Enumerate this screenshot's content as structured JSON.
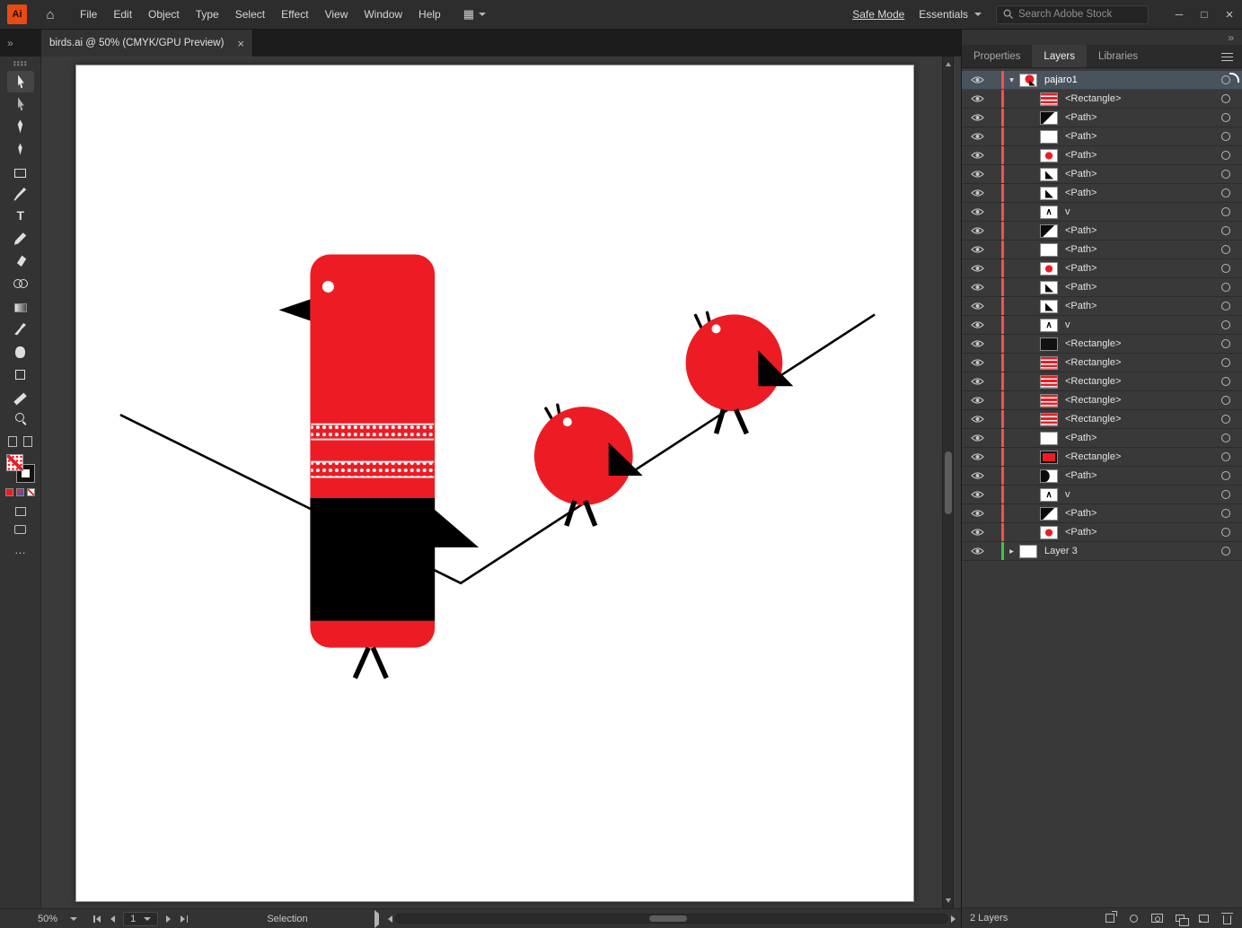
{
  "colors": {
    "art-red": "#ED1C24",
    "art-black": "#000000",
    "layer-red": "#ff4d4d",
    "layer-green": "#3ec14e",
    "row-selected": "#48535e"
  },
  "menubar": {
    "logo_text": "Ai",
    "home_icon": "⌂",
    "menus": [
      {
        "label": "File",
        "name": "menu-file"
      },
      {
        "label": "Edit",
        "name": "menu-edit"
      },
      {
        "label": "Object",
        "name": "menu-object"
      },
      {
        "label": "Type",
        "name": "menu-type"
      },
      {
        "label": "Select",
        "name": "menu-select"
      },
      {
        "label": "Effect",
        "name": "menu-effect"
      },
      {
        "label": "View",
        "name": "menu-view"
      },
      {
        "label": "Window",
        "name": "menu-window"
      },
      {
        "label": "Help",
        "name": "menu-help"
      }
    ],
    "safe_mode_label": "Safe Mode",
    "workspace_label": "Essentials",
    "search_placeholder": "Search Adobe Stock"
  },
  "tabbar": {
    "document_title": "birds.ai @ 50% (CMYK/GPU Preview)"
  },
  "toolbar": {
    "tools": [
      {
        "name": "selection-tool",
        "icon": "selection-icon",
        "active": true
      },
      {
        "name": "direct-selection-tool",
        "icon": "direct-selection-icon"
      },
      {
        "name": "pen-tool",
        "icon": "pen-icon"
      },
      {
        "name": "curvature-tool",
        "icon": "curvature-icon"
      },
      {
        "name": "rectangle-tool",
        "icon": "rectangle-icon"
      },
      {
        "name": "paintbrush-tool",
        "icon": "paintbrush-icon"
      },
      {
        "name": "type-tool",
        "icon": "type-icon"
      },
      {
        "name": "pencil-tool",
        "icon": "pencil-icon"
      },
      {
        "name": "eraser-tool",
        "icon": "eraser-icon"
      },
      {
        "name": "shape-builder-tool",
        "icon": "shape-builder-icon"
      },
      {
        "name": "gradient-tool",
        "icon": "gradient-icon"
      },
      {
        "name": "eyedropper-tool",
        "icon": "eyedropper-icon"
      },
      {
        "name": "hand-tool",
        "icon": "hand-icon"
      },
      {
        "name": "artboard-tool",
        "icon": "artboard-icon"
      },
      {
        "name": "measure-tool",
        "icon": "measure-icon"
      },
      {
        "name": "zoom-tool",
        "icon": "zoom-icon"
      }
    ]
  },
  "statusbar": {
    "zoom": "50%",
    "page": "1",
    "tool": "Selection"
  },
  "panel": {
    "tabs": [
      {
        "label": "Properties",
        "name": "tab-properties",
        "active": false
      },
      {
        "label": "Layers",
        "name": "tab-layers",
        "active": true
      },
      {
        "label": "Libraries",
        "name": "tab-libraries",
        "active": false
      }
    ],
    "layers": [
      {
        "name": "pajaro1",
        "thumb": "bird",
        "level": 0,
        "color": "red",
        "selected": true,
        "expanded": true
      },
      {
        "name": "<Rectangle>",
        "thumb": "stripes",
        "level": 1,
        "color": "red"
      },
      {
        "name": "<Path>",
        "thumb": "diag",
        "level": 1,
        "color": "red"
      },
      {
        "name": "<Path>",
        "thumb": "white",
        "level": 1,
        "color": "red"
      },
      {
        "name": "<Path>",
        "thumb": "redcircle",
        "level": 1,
        "color": "red"
      },
      {
        "name": "<Path>",
        "thumb": "tri",
        "level": 1,
        "color": "red"
      },
      {
        "name": "<Path>",
        "thumb": "tri",
        "level": 1,
        "color": "red"
      },
      {
        "name": "v",
        "thumb": "legs",
        "level": 1,
        "color": "red"
      },
      {
        "name": "<Path>",
        "thumb": "diag",
        "level": 1,
        "color": "red"
      },
      {
        "name": "<Path>",
        "thumb": "white",
        "level": 1,
        "color": "red"
      },
      {
        "name": "<Path>",
        "thumb": "redcircle",
        "level": 1,
        "color": "red"
      },
      {
        "name": "<Path>",
        "thumb": "tri",
        "level": 1,
        "color": "red"
      },
      {
        "name": "<Path>",
        "thumb": "tri",
        "level": 1,
        "color": "red"
      },
      {
        "name": "v",
        "thumb": "legs",
        "level": 1,
        "color": "red"
      },
      {
        "name": "<Rectangle>",
        "thumb": "black",
        "level": 1,
        "color": "red"
      },
      {
        "name": "<Rectangle>",
        "thumb": "stripes",
        "level": 1,
        "color": "red"
      },
      {
        "name": "<Rectangle>",
        "thumb": "stripes",
        "level": 1,
        "color": "red"
      },
      {
        "name": "<Rectangle>",
        "thumb": "stripes",
        "level": 1,
        "color": "red"
      },
      {
        "name": "<Rectangle>",
        "thumb": "stripes",
        "level": 1,
        "color": "red"
      },
      {
        "name": "<Path>",
        "thumb": "white",
        "level": 1,
        "color": "red"
      },
      {
        "name": "<Rectangle>",
        "thumb": "redborder",
        "level": 1,
        "color": "red"
      },
      {
        "name": "<Path>",
        "thumb": "half",
        "level": 1,
        "color": "red"
      },
      {
        "name": "v",
        "thumb": "legs",
        "level": 1,
        "color": "red"
      },
      {
        "name": "<Path>",
        "thumb": "diag",
        "level": 1,
        "color": "red"
      },
      {
        "name": "<Path>",
        "thumb": "redcircle",
        "level": 1,
        "color": "red"
      },
      {
        "name": "Layer 3",
        "thumb": "white",
        "level": 0,
        "color": "green",
        "expanded": false
      }
    ],
    "status": "2 Layers",
    "footer_icons": [
      {
        "name": "collect-export-button",
        "icon": "collect-export-icon"
      },
      {
        "name": "locate-object-button",
        "icon": "locate-object-icon"
      },
      {
        "name": "make-mask-button",
        "icon": "make-mask-icon"
      },
      {
        "name": "new-sublayer-button",
        "icon": "new-sublayer-icon"
      },
      {
        "name": "new-layer-button",
        "icon": "new-layer-icon"
      },
      {
        "name": "delete-selection-button",
        "icon": "delete-icon"
      }
    ]
  }
}
